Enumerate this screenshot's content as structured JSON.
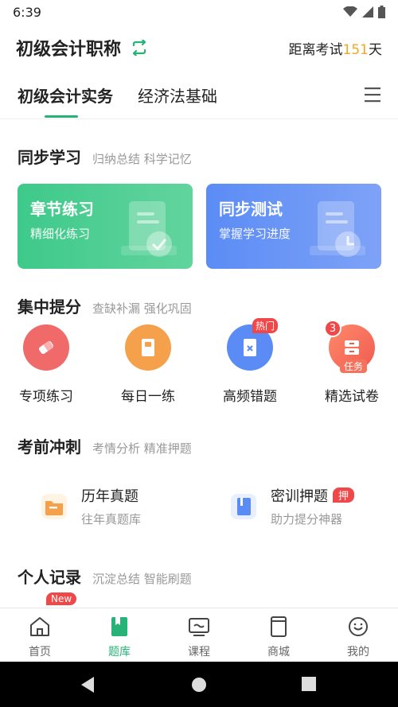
{
  "status": {
    "time": "6:39"
  },
  "header": {
    "title": "初级会计职称",
    "countdown_prefix": "距离考试",
    "countdown_days": "151",
    "countdown_suffix": "天"
  },
  "tabs": [
    {
      "label": "初级会计实务"
    },
    {
      "label": "经济法基础"
    }
  ],
  "sync": {
    "title": "同步学习",
    "subtitle": "归纳总结 科学记忆",
    "cards": [
      {
        "title": "章节练习",
        "subtitle": "精细化练习",
        "color": "#3ec98a"
      },
      {
        "title": "同步测试",
        "subtitle": "掌握学习进度",
        "color": "#5b8cf5"
      }
    ]
  },
  "focus": {
    "title": "集中提分",
    "subtitle": "查缺补漏 强化巩固",
    "items": [
      {
        "label": "专项练习",
        "icon": "eraser-icon",
        "color": "#f06a6a"
      },
      {
        "label": "每日一练",
        "icon": "book-icon",
        "color": "#f5a04a"
      },
      {
        "label": "高频错题",
        "icon": "wrong-answer-icon",
        "color": "#5b8cf5",
        "badge": "热门"
      },
      {
        "label": "精选试卷",
        "icon": "drawer-icon",
        "color": "#f5735c",
        "count": "3",
        "tag": "任务"
      }
    ]
  },
  "sprint": {
    "title": "考前冲刺",
    "subtitle": "考情分析 精准押题",
    "items": [
      {
        "title": "历年真题",
        "subtitle": "往年真题库",
        "icon": "folder-icon"
      },
      {
        "title": "密训押题",
        "subtitle": "助力提分神器",
        "icon": "notebook-icon",
        "badge": "押"
      }
    ]
  },
  "records": {
    "title": "个人记录",
    "subtitle": "沉淀总结 智能刷题",
    "new_badge": "New"
  },
  "bottom_nav": [
    {
      "label": "首页",
      "icon": "home-icon"
    },
    {
      "label": "题库",
      "icon": "question-bank-icon"
    },
    {
      "label": "课程",
      "icon": "course-icon"
    },
    {
      "label": "商城",
      "icon": "store-icon"
    },
    {
      "label": "我的",
      "icon": "profile-icon"
    }
  ],
  "colors": {
    "accent": "#27b377",
    "highlight": "#f5a623",
    "badge": "#f04848"
  }
}
